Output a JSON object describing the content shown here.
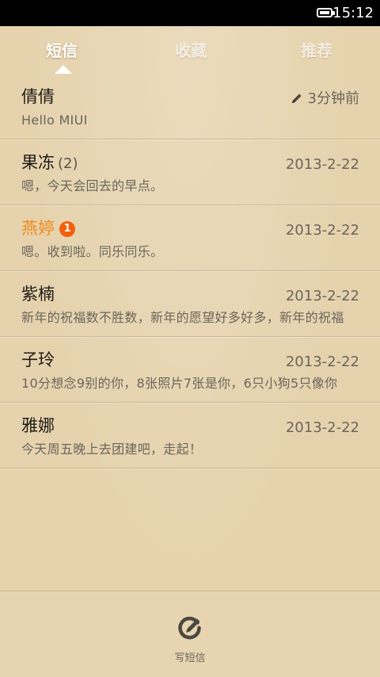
{
  "status_bar": {
    "time": "15:12",
    "battery_icon": "battery-full-icon"
  },
  "tabs": [
    {
      "label": "短信",
      "active": true
    },
    {
      "label": "收藏",
      "active": false
    },
    {
      "label": "推荐",
      "active": false
    }
  ],
  "messages": [
    {
      "name": "倩倩",
      "preview": "Hello MIUI",
      "date": "3分钟前",
      "draft": true
    },
    {
      "name": "果冻",
      "count": "(2)",
      "preview": "嗯，今天会回去的早点。",
      "date": "2013-2-22"
    },
    {
      "name": "燕婷",
      "badge": "1",
      "preview": "嗯。收到啦。同乐同乐。",
      "date": "2013-2-22",
      "unread": true
    },
    {
      "name": "紫楠",
      "preview": "新年的祝福数不胜数，新年的愿望好多好多，新年的祝福",
      "date": "2013-2-22"
    },
    {
      "name": "子玲",
      "preview": "10分想念9别的你，8张照片7张是你，6只小狗5只像你",
      "date": "2013-2-22"
    },
    {
      "name": "雅娜",
      "preview": "今天周五晚上去团建吧，走起！",
      "date": "2013-2-22"
    }
  ],
  "bottom_bar": {
    "compose_label": "写短信",
    "compose_icon": "compose-icon"
  },
  "colors": {
    "background": "#e6d3ae",
    "unread_accent": "#f08a1c",
    "badge": "#f2600c"
  }
}
